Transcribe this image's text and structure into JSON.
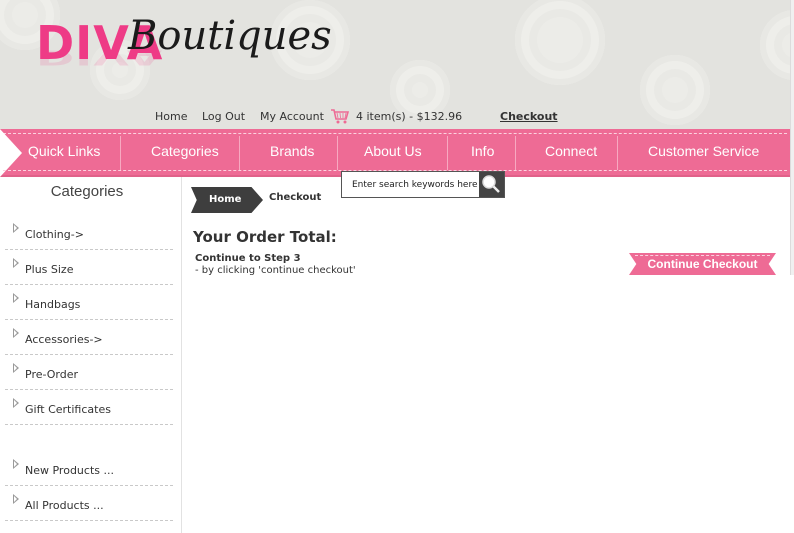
{
  "brand": {
    "name_primary": "DIVA",
    "name_secondary": "Boutiques"
  },
  "toplinks": {
    "home": "Home",
    "logout": "Log Out",
    "account": "My Account",
    "cart_summary": "4 item(s) - $132.96",
    "checkout": "Checkout"
  },
  "nav": {
    "items": [
      "Quick Links",
      "Categories",
      "Brands",
      "About Us",
      "Info",
      "Connect",
      "Customer Service"
    ]
  },
  "search": {
    "placeholder": "Enter search keywords here"
  },
  "sidebar": {
    "title": "Categories",
    "items": [
      "Clothing->",
      "Plus Size",
      "Handbags",
      "Accessories->",
      "Pre-Order",
      "Gift Certificates",
      "New Products ...",
      "All Products ..."
    ]
  },
  "breadcrumb": {
    "home": "Home",
    "current": "Checkout"
  },
  "main": {
    "title": "Your Order Total:",
    "step_title": "Continue to Step 3",
    "step_desc": "- by clicking 'continue checkout'",
    "continue_label": "Continue Checkout"
  },
  "colors": {
    "accent_pink": "#ee6b95",
    "logo_pink": "#ee3b86",
    "header_bg": "#e3e3df",
    "dark": "#3e3e3e"
  }
}
